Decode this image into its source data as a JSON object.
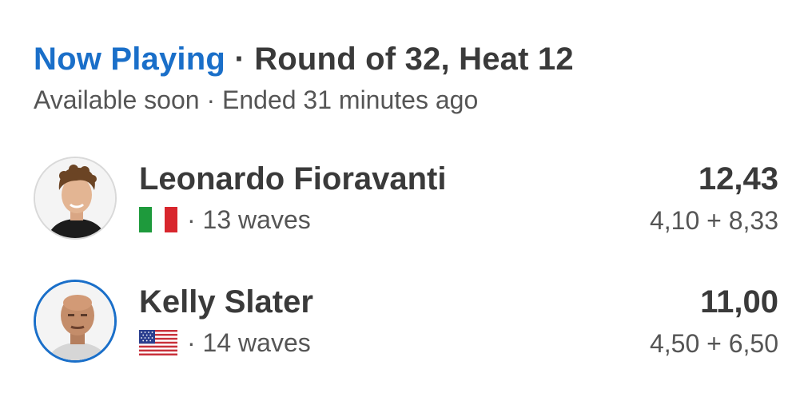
{
  "header": {
    "now_playing": "Now Playing",
    "separator": "·",
    "heat_title": "Round of 32, Heat 12",
    "status": "Available soon · Ended 31 minutes ago"
  },
  "athletes": [
    {
      "name": "Leonardo Fioravanti",
      "flag_icon": "italy-flag-icon",
      "waves": "· 13 waves",
      "total": "12,43",
      "wave_scores": "4,10 + 8,33"
    },
    {
      "name": "Kelly Slater",
      "flag_icon": "usa-flag-icon",
      "waves": "· 14 waves",
      "total": "11,00",
      "wave_scores": "4,50 + 6,50"
    }
  ],
  "colors": {
    "accent": "#1a6fc9",
    "text_dark": "#3a3a3a",
    "text_muted": "#555555"
  }
}
